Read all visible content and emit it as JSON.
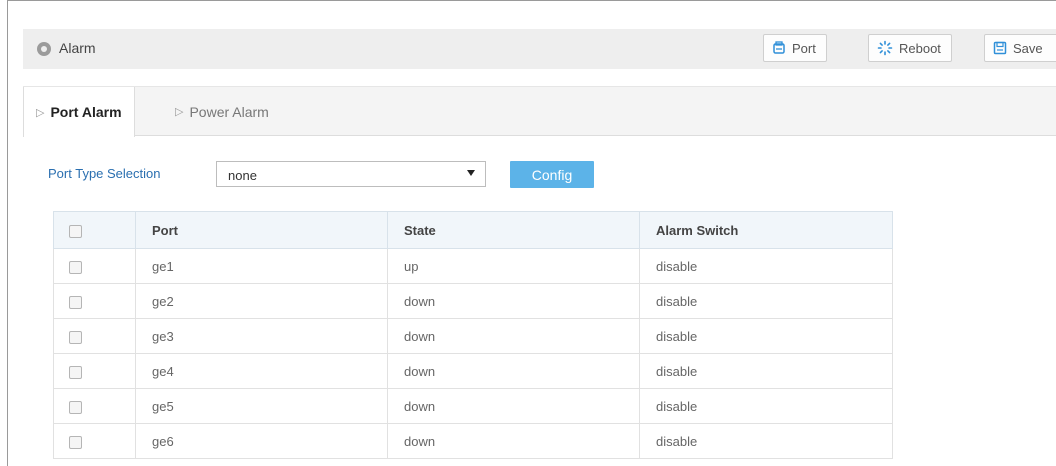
{
  "header": {
    "title": "Alarm",
    "buttons": {
      "port": "Port",
      "reboot": "Reboot",
      "save": "Save"
    }
  },
  "tabs": [
    {
      "label": "Port Alarm",
      "active": true
    },
    {
      "label": "Power Alarm",
      "active": false
    }
  ],
  "form": {
    "label": "Port Type Selection",
    "select_value": "none",
    "config_label": "Config"
  },
  "table": {
    "columns": [
      "Port",
      "State",
      "Alarm Switch"
    ],
    "rows": [
      {
        "port": "ge1",
        "state": "up",
        "alarm": "disable"
      },
      {
        "port": "ge2",
        "state": "down",
        "alarm": "disable"
      },
      {
        "port": "ge3",
        "state": "down",
        "alarm": "disable"
      },
      {
        "port": "ge4",
        "state": "down",
        "alarm": "disable"
      },
      {
        "port": "ge5",
        "state": "down",
        "alarm": "disable"
      },
      {
        "port": "ge6",
        "state": "down",
        "alarm": "disable"
      }
    ]
  },
  "colors": {
    "accent": "#5cb3e8",
    "label_blue": "#2a6fb0",
    "header_bg": "#eeeeee",
    "icon_blue": "#2f8fd8"
  }
}
